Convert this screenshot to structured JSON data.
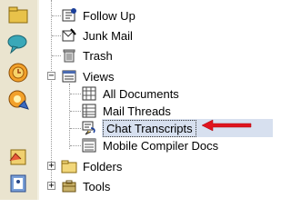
{
  "left_bar": {
    "icons": [
      "folder-icon",
      "chat-bubble-icon",
      "clock-icon",
      "compass-icon",
      "notes-icon",
      "address-book-icon"
    ]
  },
  "tree": {
    "items": [
      {
        "label": "Follow Up",
        "icon": "follow-up-icon"
      },
      {
        "label": "Junk Mail",
        "icon": "junk-mail-icon"
      },
      {
        "label": "Trash",
        "icon": "trash-icon"
      },
      {
        "label": "Views",
        "icon": "views-icon",
        "expanded": true,
        "expander": "−"
      },
      {
        "label": "All Documents",
        "icon": "all-documents-icon"
      },
      {
        "label": "Mail Threads",
        "icon": "mail-threads-icon"
      },
      {
        "label": "Chat Transcripts",
        "icon": "chat-transcripts-icon",
        "selected": true
      },
      {
        "label": "Mobile Compiler Docs",
        "icon": "mobile-compiler-docs-icon"
      },
      {
        "label": "Folders",
        "icon": "folders-icon",
        "expanded": false,
        "expander": "+"
      },
      {
        "label": "Tools",
        "icon": "tools-icon",
        "expanded": false,
        "expander": "+"
      }
    ]
  },
  "colors": {
    "selection": "#d7e0ef",
    "arrow": "#e0141e",
    "left_bar": "#eae4cf"
  }
}
